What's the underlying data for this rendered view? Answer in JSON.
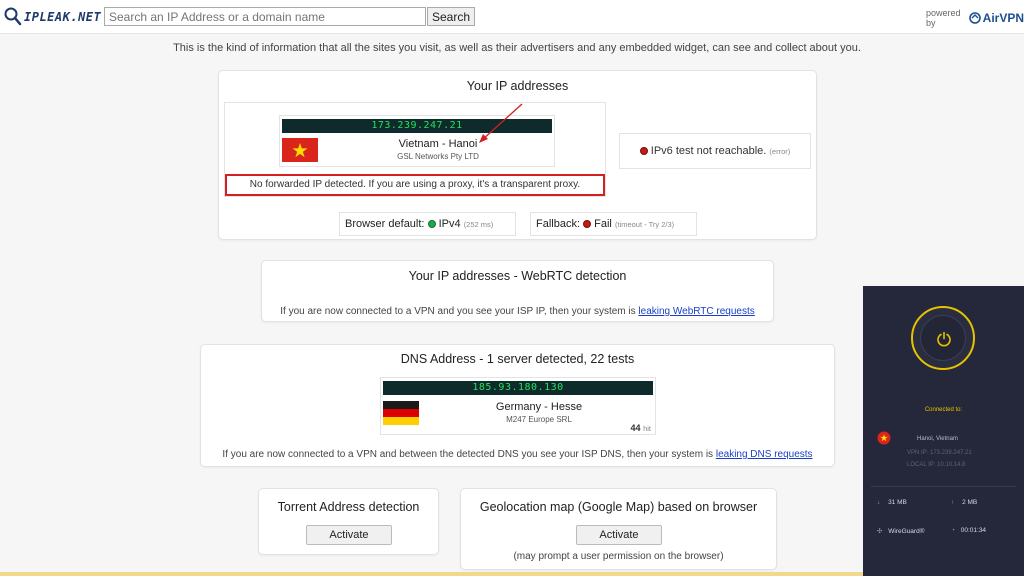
{
  "header": {
    "logo_text": "IPLEAK.NET",
    "search_placeholder": "Search an IP Address or a domain name",
    "search_button": "Search",
    "powered_by": "powered by",
    "airvpn": "AirVPN"
  },
  "intro": "This is the kind of information that all the sites you visit, as well as their advertisers and any embedded widget, can see and collect about you.",
  "ip_section": {
    "title": "Your IP addresses",
    "ip": "173.239.247.21",
    "location": "Vietnam - Hanoi",
    "isp": "GSL Networks Pty LTD",
    "forwarded_notice": "No forwarded IP detected. If you are using a proxy, it's a transparent proxy.",
    "ipv6_text": "IPv6 test not reachable.",
    "ipv6_note": "(error)",
    "browser_default_label": "Browser default:",
    "browser_default_value": "IPv4",
    "browser_default_ms": "(252 ms)",
    "fallback_label": "Fallback:",
    "fallback_value": "Fail",
    "fallback_note": "(timeout - Try 2/3)"
  },
  "webrtc": {
    "title": "Your IP addresses - WebRTC detection",
    "text": "If you are now connected to a VPN and you see your ISP IP, then your system is",
    "link": "leaking WebRTC requests"
  },
  "dns": {
    "title": "DNS Address - 1 server detected, 22 tests",
    "ip": "185.93.180.130",
    "location": "Germany - Hesse",
    "isp": "M247 Europe SRL",
    "hits": "44",
    "hits_label": "hit",
    "text": "If you are now connected to a VPN and between the detected DNS you see your ISP DNS, then your system is",
    "link": "leaking DNS requests"
  },
  "torrent": {
    "title": "Torrent Address detection",
    "button": "Activate"
  },
  "geo": {
    "title": "Geolocation map (Google Map) based on browser",
    "button": "Activate",
    "note": "(may prompt a user permission on the browser)"
  },
  "vpn_panel": {
    "status": "Connected to:",
    "location": "Hanoi, Vietnam",
    "vpn_ip": "VPN IP: 173.239.247.21",
    "local_ip": "LOCAL IP: 10.10.14.8",
    "download": "31 MB",
    "upload": "2 MB",
    "protocol": "WireGuard®",
    "duration": "00:01:34"
  },
  "colors": {
    "ip_bar_bg": "#0e2a2a",
    "ip_bar_text": "#21e35c",
    "highlight_border": "#d42020",
    "vpn_accent": "#e6c200",
    "link": "#1a3ec7"
  }
}
